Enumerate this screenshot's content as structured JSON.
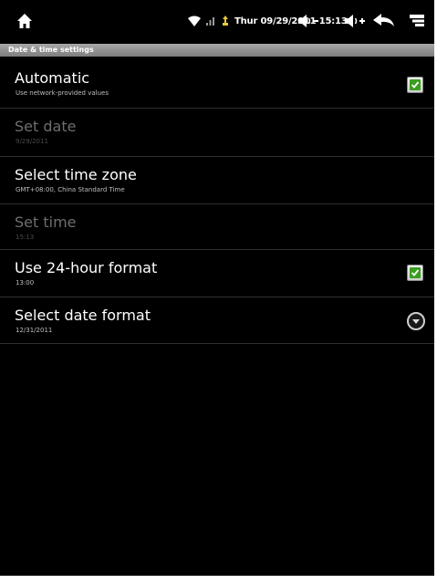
{
  "status_bar": {
    "clock": "Thur 09/29/2011 15:13",
    "icons": [
      "home-icon",
      "wifi-icon",
      "signal-icon",
      "usb-icon",
      "volume-down-icon",
      "volume-up-icon",
      "back-icon",
      "menu-icon"
    ]
  },
  "header": {
    "title": "Date & time settings"
  },
  "settings": [
    {
      "title": "Automatic",
      "summary": "Use network-provided values",
      "enabled": true,
      "control": "checkbox",
      "checked": true
    },
    {
      "title": "Set date",
      "summary": "9/29/2011",
      "enabled": false,
      "control": "none"
    },
    {
      "title": "Select time zone",
      "summary": "GMT+08:00, China Standard Time",
      "enabled": true,
      "control": "none"
    },
    {
      "title": "Set time",
      "summary": "15:13",
      "enabled": false,
      "control": "none"
    },
    {
      "title": "Use 24-hour format",
      "summary": "13:00",
      "enabled": true,
      "control": "checkbox",
      "checked": true
    },
    {
      "title": "Select date format",
      "summary": "12/31/2011",
      "enabled": true,
      "control": "dropdown"
    }
  ],
  "colors": {
    "background": "#000000",
    "header_bg": "#8c8c8c",
    "check_green": "#3a9e1f",
    "disabled_text": "#6e6e6e"
  }
}
